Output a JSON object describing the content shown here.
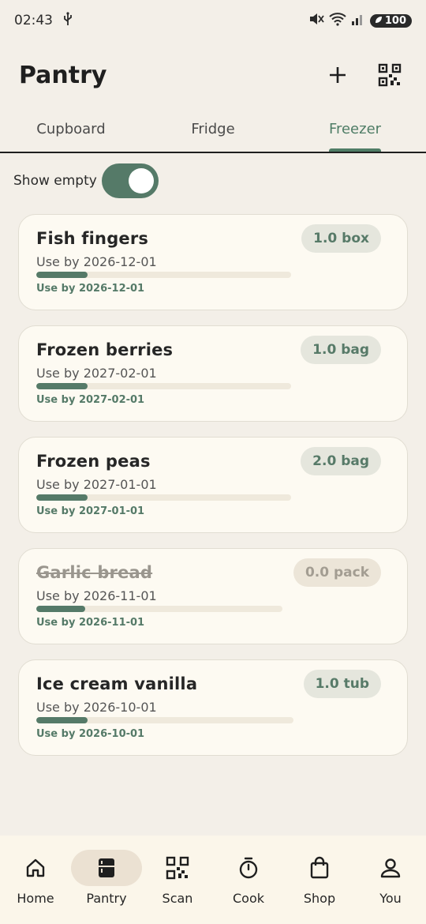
{
  "status_bar": {
    "time": "02:43",
    "battery": "100"
  },
  "header": {
    "title": "Pantry"
  },
  "tabs": [
    {
      "label": "Cupboard",
      "active": false
    },
    {
      "label": "Fridge",
      "active": false
    },
    {
      "label": "Freezer",
      "active": true
    }
  ],
  "toggle": {
    "label": "Show empty",
    "on": true
  },
  "items": [
    {
      "name": "Fish fingers",
      "qty": "1.0 box",
      "use_by": "Use by 2026-12-01",
      "use_by_small": "Use by 2026-12-01",
      "progress": 0.2,
      "empty": false
    },
    {
      "name": "Frozen berries",
      "qty": "1.0 bag",
      "use_by": "Use by 2027-02-01",
      "use_by_small": "Use by 2027-02-01",
      "progress": 0.2,
      "empty": false
    },
    {
      "name": "Frozen peas",
      "qty": "2.0 bag",
      "use_by": "Use by 2027-01-01",
      "use_by_small": "Use by 2027-01-01",
      "progress": 0.2,
      "empty": false
    },
    {
      "name": "Garlic bread",
      "qty": "0.0 pack",
      "use_by": "Use by 2026-11-01",
      "use_by_small": "Use by 2026-11-01",
      "progress": 0.2,
      "empty": true
    },
    {
      "name": "Ice cream vanilla",
      "qty": "1.0 tub",
      "use_by": "Use by 2026-10-01",
      "use_by_small": "Use by 2026-10-01",
      "progress": 0.2,
      "empty": false
    }
  ],
  "nav": [
    {
      "label": "Home",
      "icon": "home-icon",
      "active": false
    },
    {
      "label": "Pantry",
      "icon": "pantry-icon",
      "active": true
    },
    {
      "label": "Scan",
      "icon": "qr-icon",
      "active": false
    },
    {
      "label": "Cook",
      "icon": "timer-icon",
      "active": false
    },
    {
      "label": "Shop",
      "icon": "bag-icon",
      "active": false
    },
    {
      "label": "You",
      "icon": "person-icon",
      "active": false
    }
  ],
  "colors": {
    "accent": "#557a68",
    "background": "#f3efe8",
    "card": "#fdfaf2"
  }
}
